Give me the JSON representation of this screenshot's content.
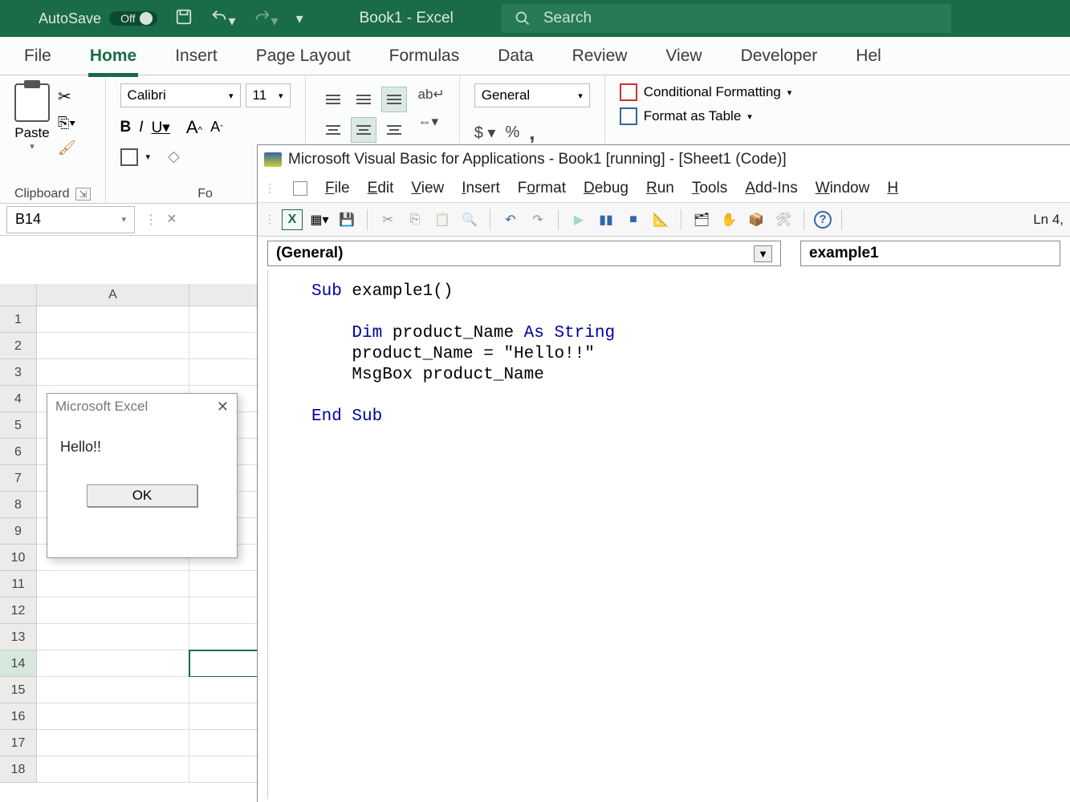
{
  "titlebar": {
    "autosave_label": "AutoSave",
    "autosave_state": "Off",
    "doc_title": "Book1 - Excel",
    "search_placeholder": "Search"
  },
  "ribbon_tabs": [
    "File",
    "Home",
    "Insert",
    "Page Layout",
    "Formulas",
    "Data",
    "Review",
    "View",
    "Developer",
    "Hel"
  ],
  "active_tab": "Home",
  "clipboard": {
    "paste_label": "Paste",
    "group_label": "Clipboard"
  },
  "font": {
    "name": "Calibri",
    "size": "11",
    "bold": "B",
    "italic": "I",
    "underline": "U",
    "grow": "A",
    "shrink": "A",
    "group_label": "Fo"
  },
  "alignment": {
    "wrap": "ab"
  },
  "number": {
    "format": "General",
    "dollar": "$",
    "percent": "%",
    "comma": ","
  },
  "styles": {
    "cond_format": "Conditional Formatting",
    "format_table": "Format as Table"
  },
  "namebox": "B14",
  "columns": [
    "A"
  ],
  "rows": [
    "1",
    "2",
    "3",
    "4",
    "5",
    "6",
    "7",
    "8",
    "9",
    "10",
    "11",
    "12",
    "13",
    "14",
    "15",
    "16",
    "17",
    "18"
  ],
  "active_cell_col": "B",
  "active_cell_row": "14",
  "msgbox": {
    "title": "Microsoft Excel",
    "message": "Hello!!",
    "ok": "OK"
  },
  "vba": {
    "title": "Microsoft Visual Basic for Applications - Book1 [running] - [Sheet1 (Code)]",
    "menus": [
      "File",
      "Edit",
      "View",
      "Insert",
      "Format",
      "Debug",
      "Run",
      "Tools",
      "Add-Ins",
      "Window",
      "H"
    ],
    "line_col": "Ln 4,",
    "dd_left": "(General)",
    "dd_right": "example1",
    "code_lines": [
      {
        "indent": 0,
        "kw": "Sub",
        "rest": " example1()"
      },
      {
        "indent": 0,
        "kw": "",
        "rest": ""
      },
      {
        "indent": 1,
        "kw": "Dim",
        "rest": " product_Name ",
        "kw2": "As String"
      },
      {
        "indent": 1,
        "kw": "",
        "rest": "product_Name = \"Hello!!\""
      },
      {
        "indent": 1,
        "kw": "",
        "rest": "MsgBox product_Name"
      },
      {
        "indent": 0,
        "kw": "",
        "rest": ""
      },
      {
        "indent": 0,
        "kw": "End Sub",
        "rest": ""
      }
    ]
  }
}
